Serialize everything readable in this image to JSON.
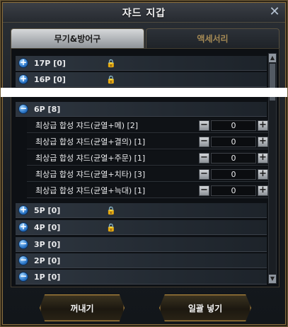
{
  "window": {
    "title": "쟈드 지갑"
  },
  "tabs": [
    {
      "label": "무기&방어구"
    },
    {
      "label": "액세서리"
    }
  ],
  "groups": [
    {
      "label": "17P [0]"
    },
    {
      "label": "16P [0]"
    },
    {
      "label": "6P [8]"
    },
    {
      "label": "5P [0]"
    },
    {
      "label": "4P [0]"
    },
    {
      "label": "3P [0]"
    },
    {
      "label": "2P [0]"
    },
    {
      "label": "1P [0]"
    }
  ],
  "items": [
    {
      "label": "최상급 합성 쟈드(균열+메) [2]",
      "value": "0"
    },
    {
      "label": "최상급 합성 쟈드(균열+결의) [1]",
      "value": "0"
    },
    {
      "label": "최상급 합성 쟈드(균열+주문) [1]",
      "value": "0"
    },
    {
      "label": "최상급 합성 쟈드(균열+치타) [3]",
      "value": "0"
    },
    {
      "label": "최상급 합성 쟈드(균열+늑대) [1]",
      "value": "0"
    }
  ],
  "buttons": {
    "withdraw": "꺼내기",
    "insert_all": "일괄 넣기"
  },
  "stepper": {
    "minus": "−",
    "plus": "+"
  }
}
